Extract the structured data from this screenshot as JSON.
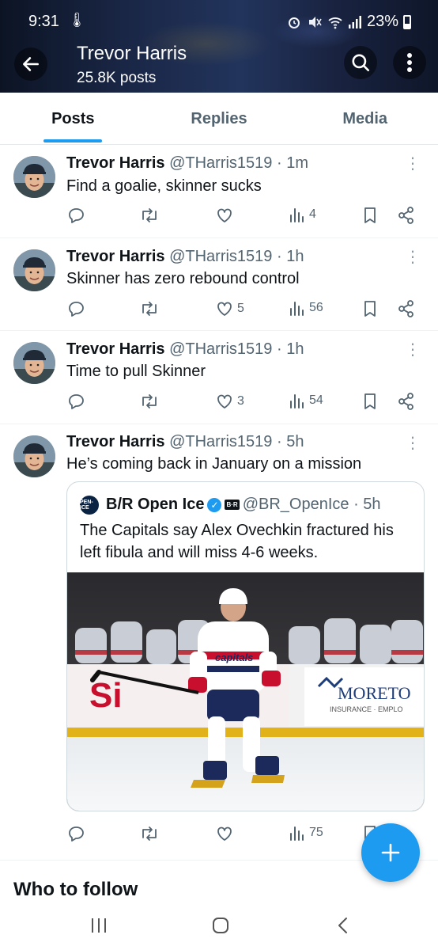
{
  "status": {
    "time": "9:31",
    "battery": "23%"
  },
  "header": {
    "name": "Trevor Harris",
    "posts_count": "25.8K posts"
  },
  "tabs": [
    {
      "label": "Posts",
      "active": true
    },
    {
      "label": "Replies",
      "active": false
    },
    {
      "label": "Media",
      "active": false
    }
  ],
  "posts": [
    {
      "name": "Trevor Harris",
      "handle": "@THarris1519",
      "time": "· 1m",
      "text": "Find a goalie, skinner sucks",
      "likes": "",
      "views": "4"
    },
    {
      "name": "Trevor Harris",
      "handle": "@THarris1519",
      "time": "· 1h",
      "text": "Skinner has zero rebound control",
      "likes": "5",
      "views": "56"
    },
    {
      "name": "Trevor Harris",
      "handle": "@THarris1519",
      "time": "· 1h",
      "text": "Time to pull Skinner",
      "likes": "3",
      "views": "54"
    },
    {
      "name": "Trevor Harris",
      "handle": "@THarris1519",
      "time": "· 5h",
      "text": "He’s coming back in January on a mission",
      "likes": "",
      "views": "75"
    }
  ],
  "quote": {
    "logo_text": "PEN-ICE",
    "name": "B/R Open Ice",
    "badge_text": "B·R",
    "handle": "@BR_OpenIce",
    "time": "· 5h",
    "text": "The Capitals say Alex Ovechkin fractured his left fibula and will miss 4-6 weeks.",
    "image_sign_text": "MORETO",
    "image_sign_sub": "INSURANCE · EMPLO",
    "image_board_text": "Si",
    "jersey_text": "capitals"
  },
  "who_to_follow": {
    "title": "Who to follow"
  },
  "colors": {
    "accent": "#1d9bf0",
    "text": "#0f1419",
    "muted": "#536471"
  },
  "icons": [
    "back-arrow-icon",
    "search-icon",
    "more-vertical-icon",
    "reply-icon",
    "retweet-icon",
    "like-icon",
    "views-icon",
    "bookmark-icon",
    "share-icon",
    "compose-plus-icon",
    "nav-recents-icon",
    "nav-home-icon",
    "nav-back-icon"
  ]
}
